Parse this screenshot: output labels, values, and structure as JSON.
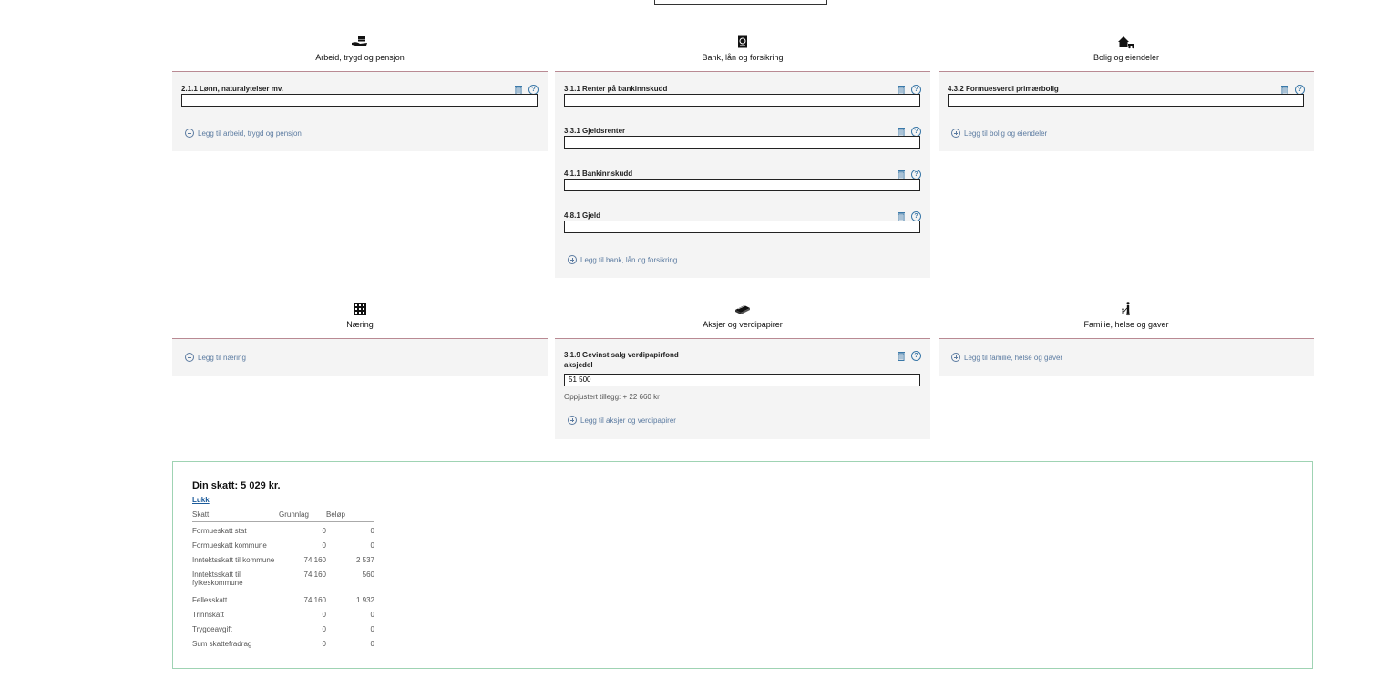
{
  "categories": [
    {
      "title": "Arbeid, trygd og pensjon",
      "add_label": "Legg til arbeid, trygd og pensjon",
      "fields": [
        {
          "label": "2.1.1 Lønn, naturalytelser mv.",
          "value": ""
        }
      ]
    },
    {
      "title": "Bank, lån og forsikring",
      "add_label": "Legg til bank, lån og forsikring",
      "fields": [
        {
          "label": "3.1.1 Renter på bankinnskudd",
          "value": ""
        },
        {
          "label": "3.3.1 Gjeldsrenter",
          "value": ""
        },
        {
          "label": "4.1.1 Bankinnskudd",
          "value": ""
        },
        {
          "label": "4.8.1 Gjeld",
          "value": ""
        }
      ]
    },
    {
      "title": "Bolig og eiendeler",
      "add_label": "Legg til bolig og eiendeler",
      "fields": [
        {
          "label": "4.3.2 Formuesverdi primærbolig",
          "value": ""
        }
      ]
    },
    {
      "title": "Næring",
      "add_label": "Legg til næring",
      "fields": []
    },
    {
      "title": "Aksjer og verdipapirer",
      "add_label": "Legg til aksjer og verdipapirer",
      "fields": [
        {
          "label_line1": "3.1.9 Gevinst salg verdipapirfond",
          "label_line2": "aksjedel",
          "value": "51 500",
          "note": "Oppjustert tillegg: + 22 660 kr"
        }
      ]
    },
    {
      "title": "Familie, helse og gaver",
      "add_label": "Legg til familie, helse og gaver",
      "fields": []
    }
  ],
  "help_glyph": "?",
  "tax": {
    "title": "Din skatt: 5 029 kr.",
    "close_label": "Lukk",
    "columns": [
      "Skatt",
      "Grunnlag",
      "Beløp"
    ],
    "rows": [
      {
        "name": "Formueskatt stat",
        "base": "0",
        "amount": "0"
      },
      {
        "name": "Formueskatt kommune",
        "base": "0",
        "amount": "0"
      },
      {
        "name": "Inntektsskatt til kommune",
        "base": "74 160",
        "amount": "2 537"
      },
      {
        "name": "Inntektsskatt til",
        "name2": "fylkeskommune",
        "base": "74 160",
        "amount": "560"
      },
      {
        "name": "Fellesskatt",
        "base": "74 160",
        "amount": "1 932"
      },
      {
        "name": "Trinnskatt",
        "base": "0",
        "amount": "0"
      },
      {
        "name": "Trygdeavgift",
        "base": "0",
        "amount": "0"
      },
      {
        "name": "Sum skattefradrag",
        "base": "0",
        "amount": "0"
      }
    ]
  },
  "icons": [
    "hand-money-icon",
    "passport-icon",
    "house-car-icon",
    "building-icon",
    "money-stack-icon",
    "family-icon",
    "trash-icon",
    "help-icon",
    "plus-circle-icon"
  ]
}
